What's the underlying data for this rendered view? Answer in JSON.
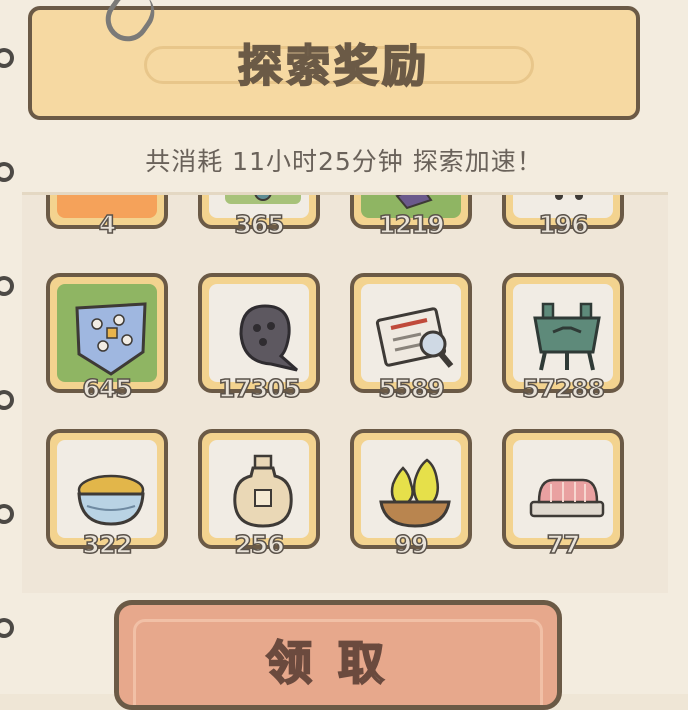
{
  "header": {
    "title": "探索奖励"
  },
  "summary": "共消耗  11小时25分钟  探索加速！",
  "rewards_partial_row": [
    {
      "icon": "orange-item-icon",
      "count": "4"
    },
    {
      "icon": "green-item-icon",
      "count": "365"
    },
    {
      "icon": "purple-item-icon",
      "count": "1219"
    },
    {
      "icon": "green-item-icon",
      "count": "196"
    }
  ],
  "rewards_row_1": [
    {
      "icon": "patterned-cloth-icon",
      "count": "645"
    },
    {
      "icon": "dark-tadpole-icon",
      "count": "17305"
    },
    {
      "icon": "newspaper-magnifier-icon",
      "count": "5589"
    },
    {
      "icon": "bronze-cauldron-icon",
      "count": "57288"
    }
  ],
  "rewards_row_2": [
    {
      "icon": "grain-bowl-icon",
      "count": "322"
    },
    {
      "icon": "wine-jar-icon",
      "count": "256"
    },
    {
      "icon": "pear-basket-icon",
      "count": "99"
    },
    {
      "icon": "sliced-meat-icon",
      "count": "77"
    }
  ],
  "claim_button": {
    "label": "领取"
  },
  "colors": {
    "banner": "#f6d9a2",
    "outline": "#6b5a46",
    "slot_frame": "#f3d38f",
    "button": "#e7a88c"
  }
}
